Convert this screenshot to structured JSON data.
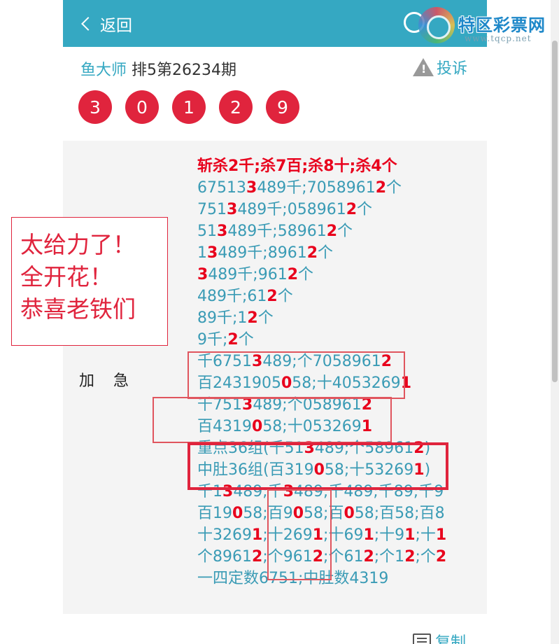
{
  "header": {
    "back_label": "返回"
  },
  "watermark": {
    "title": "特区彩票网",
    "url": "www.tqcp.net"
  },
  "post": {
    "author": "鱼大师",
    "issue": "排5第26234期",
    "complain_label": "投诉",
    "warn_icon_glyph": "!"
  },
  "balls": [
    "3",
    "0",
    "1",
    "2",
    "9"
  ],
  "stamp": {
    "lines": [
      "太给力了！",
      "全开花！",
      "恭喜老铁们"
    ]
  },
  "side_label": "加急",
  "content_lines": [
    [
      {
        "t": "斩杀2千;杀7百;杀8十;杀4个",
        "r": true
      }
    ],
    [
      {
        "t": "67513"
      },
      {
        "t": "3",
        "r": true
      },
      {
        "t": "489千;7058961"
      },
      {
        "t": "2",
        "r": true
      },
      {
        "t": "个"
      }
    ],
    [
      {
        "t": "751"
      },
      {
        "t": "3",
        "r": true
      },
      {
        "t": "489千;058961"
      },
      {
        "t": "2",
        "r": true
      },
      {
        "t": "个"
      }
    ],
    [
      {
        "t": "51"
      },
      {
        "t": "3",
        "r": true
      },
      {
        "t": "489千;58961"
      },
      {
        "t": "2",
        "r": true
      },
      {
        "t": "个"
      }
    ],
    [
      {
        "t": "1"
      },
      {
        "t": "3",
        "r": true
      },
      {
        "t": "489千;8961"
      },
      {
        "t": "2",
        "r": true
      },
      {
        "t": "个"
      }
    ],
    [
      {
        "t": "3",
        "r": true
      },
      {
        "t": "489千;961"
      },
      {
        "t": "2",
        "r": true
      },
      {
        "t": "个"
      }
    ],
    [
      {
        "t": "489千;61"
      },
      {
        "t": "2",
        "r": true
      },
      {
        "t": "个"
      }
    ],
    [
      {
        "t": "89千;1"
      },
      {
        "t": "2",
        "r": true
      },
      {
        "t": "个"
      }
    ],
    [
      {
        "t": "9千;"
      },
      {
        "t": "2",
        "r": true
      },
      {
        "t": "个"
      }
    ],
    [
      {
        "t": "千6751"
      },
      {
        "t": "3",
        "r": true
      },
      {
        "t": "489;个7058961"
      },
      {
        "t": "2",
        "r": true
      }
    ],
    [
      {
        "t": "百2431905"
      },
      {
        "t": "0",
        "r": true
      },
      {
        "t": "58;十4053269"
      },
      {
        "t": "1",
        "r": true
      }
    ],
    [
      {
        "t": "千751"
      },
      {
        "t": "3",
        "r": true
      },
      {
        "t": "489;个058961"
      },
      {
        "t": "2",
        "r": true
      }
    ],
    [
      {
        "t": "百4319"
      },
      {
        "t": "0",
        "r": true
      },
      {
        "t": "58;十053269"
      },
      {
        "t": "1",
        "r": true
      }
    ],
    [
      {
        "t": "重点36组(千51"
      },
      {
        "t": "3",
        "r": true
      },
      {
        "t": "489;个58961"
      },
      {
        "t": "2",
        "r": true
      },
      {
        "t": ")"
      }
    ],
    [
      {
        "t": "中肚36组(百319"
      },
      {
        "t": "0",
        "r": true
      },
      {
        "t": "58;十53269"
      },
      {
        "t": "1",
        "r": true
      },
      {
        "t": ")"
      }
    ],
    [
      {
        "t": "千1"
      },
      {
        "t": "3",
        "r": true
      },
      {
        "t": "489;千"
      },
      {
        "t": "3",
        "r": true
      },
      {
        "t": "489;千489;千89;千9"
      }
    ],
    [
      {
        "t": "百19"
      },
      {
        "t": "0",
        "r": true
      },
      {
        "t": "58;百9"
      },
      {
        "t": "0",
        "r": true
      },
      {
        "t": "58;百"
      },
      {
        "t": "0",
        "r": true
      },
      {
        "t": "58;百58;百8"
      }
    ],
    [
      {
        "t": "十3269"
      },
      {
        "t": "1",
        "r": true
      },
      {
        "t": ";十269"
      },
      {
        "t": "1",
        "r": true
      },
      {
        "t": ";十69"
      },
      {
        "t": "1",
        "r": true
      },
      {
        "t": ";十9"
      },
      {
        "t": "1",
        "r": true
      },
      {
        "t": ";十"
      },
      {
        "t": "1",
        "r": true
      }
    ],
    [
      {
        "t": "个8961"
      },
      {
        "t": "2",
        "r": true
      },
      {
        "t": ";个961"
      },
      {
        "t": "2",
        "r": true
      },
      {
        "t": ";个61"
      },
      {
        "t": "2",
        "r": true
      },
      {
        "t": ";个1"
      },
      {
        "t": "2",
        "r": true
      },
      {
        "t": ";个"
      },
      {
        "t": "2",
        "r": true
      }
    ],
    [
      {
        "t": "一四定数6751;中肚数4319"
      }
    ]
  ],
  "copy_label": "复制",
  "colors": {
    "accent": "#35a8c2",
    "ball": "#e0243d",
    "highlight": "#e8001c"
  }
}
